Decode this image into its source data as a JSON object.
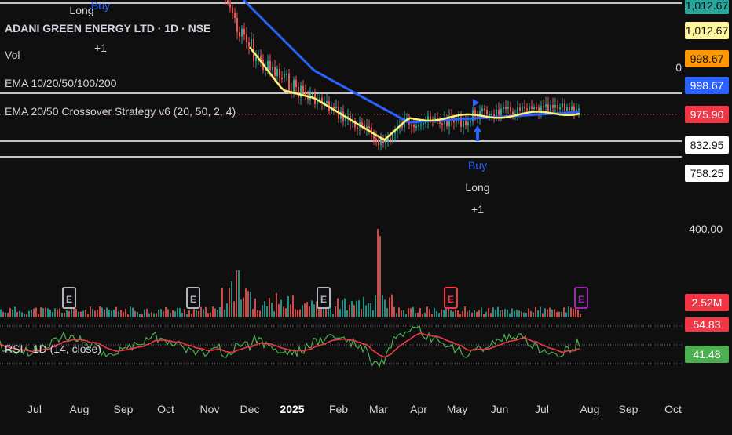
{
  "header": {
    "symbol_title": "ADANI GREEN ENERGY LTD · 1D · NSE",
    "vol_label": "Vol",
    "ema_label": "EMA 10/20/50/100/200",
    "strategy_label": "EMA 20/50 Crossover Strategy v6 (20, 50, 2, 4)",
    "rsi_label": "RSI · 1D (14, close)"
  },
  "price_scale": {
    "tags": [
      {
        "text": "1,012.67",
        "bg": "#26a69a",
        "fg": "#0f0f0f"
      },
      {
        "text": "1,012.67",
        "bg": "#fff59d",
        "fg": "#0f0f0f"
      },
      {
        "text": "998.67",
        "bg": "#ff9800",
        "fg": "#0f0f0f"
      },
      {
        "text": "998.67",
        "bg": "#2962ff",
        "fg": "#ffffff"
      },
      {
        "text": "975.90",
        "bg": "#f23645",
        "fg": "#ffffff"
      },
      {
        "text": "832.95",
        "bg": "#ffffff",
        "fg": "#0f0f0f"
      },
      {
        "text": "758.25",
        "bg": "#ffffff",
        "fg": "#0f0f0f"
      }
    ],
    "level_400": "400.00",
    "volume_tag": {
      "text": "2.52M",
      "bg": "#f23645",
      "fg": "#ffffff"
    },
    "rsi_upper_tag": {
      "text": "54.83",
      "bg": "#f23645",
      "fg": "#ffffff"
    },
    "rsi_lower_tag": {
      "text": "41.48",
      "bg": "#4caf50",
      "fg": "#ffffff"
    },
    "partial_tick": "0"
  },
  "time_axis": {
    "months": [
      "Jul",
      "Aug",
      "Sep",
      "Oct",
      "Nov",
      "Dec",
      "2025",
      "Feb",
      "Mar",
      "Apr",
      "May",
      "Jun",
      "Jul",
      "Aug",
      "Sep",
      "Oct"
    ]
  },
  "trades": {
    "top_left": {
      "line1": "Long",
      "buy": "Buy",
      "plus": "+1"
    },
    "bottom": {
      "buy": "Buy",
      "line2": "Long",
      "plus": "+1"
    }
  },
  "earnings_markers": [
    {
      "text": "E",
      "color": "#b2b5be"
    },
    {
      "text": "E",
      "color": "#b2b5be"
    },
    {
      "text": "E",
      "color": "#b2b5be"
    },
    {
      "text": "E",
      "color": "#f23645"
    },
    {
      "text": "E",
      "color": "#9c27b0"
    }
  ],
  "colors": {
    "ema_fast": "#fff176",
    "ema_slow": "#2962ff",
    "up": "#26a69a",
    "down": "#ef5350",
    "rsi": "#4caf50",
    "rsi_ma": "#f23645",
    "buy_label": "#2962ff"
  },
  "chart_data": {
    "type": "candlestick",
    "title": "ADANI GREEN ENERGY LTD · 1D · NSE",
    "current_price": 975.9,
    "levels": [
      1012.67,
      998.67,
      975.9,
      832.95,
      758.25,
      400.0
    ],
    "volume_last": "2.52M",
    "rsi_values": {
      "rsi": 41.48,
      "rsi_ma": 54.83
    },
    "x_ticks": [
      "Jul",
      "Aug",
      "Sep",
      "Oct",
      "Nov",
      "Dec",
      "2025",
      "Feb",
      "Mar",
      "Apr",
      "May",
      "Jun",
      "Jul",
      "Aug",
      "Sep",
      "Oct"
    ]
  }
}
